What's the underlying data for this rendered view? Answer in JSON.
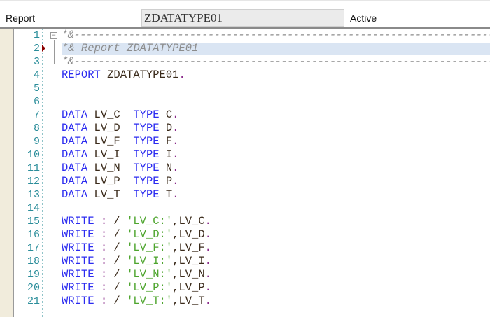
{
  "header": {
    "type_label": "Report",
    "program_name": "ZDATATYPE01",
    "status": "Active"
  },
  "editor": {
    "highlighted_line": 2,
    "lines": [
      {
        "n": "1",
        "tokens": [
          [
            "cm",
            "*&---------------------------------------------------------------------"
          ]
        ]
      },
      {
        "n": "2",
        "tokens": [
          [
            "cm",
            "*& Report ZDATATYPE01"
          ]
        ]
      },
      {
        "n": "3",
        "tokens": [
          [
            "cm",
            "*&---------------------------------------------------------------------"
          ]
        ]
      },
      {
        "n": "4",
        "tokens": [
          [
            "kw",
            "REPORT"
          ],
          [
            "tx",
            " ZDATATYPE01"
          ],
          [
            "pu",
            "."
          ]
        ]
      },
      {
        "n": "5",
        "tokens": []
      },
      {
        "n": "6",
        "tokens": []
      },
      {
        "n": "7",
        "tokens": [
          [
            "kw",
            "DATA"
          ],
          [
            "tx",
            " LV_C  "
          ],
          [
            "kw",
            "TYPE"
          ],
          [
            "tx",
            " C"
          ],
          [
            "pu",
            "."
          ]
        ]
      },
      {
        "n": "8",
        "tokens": [
          [
            "kw",
            "DATA"
          ],
          [
            "tx",
            " LV_D  "
          ],
          [
            "kw",
            "TYPE"
          ],
          [
            "tx",
            " D"
          ],
          [
            "pu",
            "."
          ]
        ]
      },
      {
        "n": "9",
        "tokens": [
          [
            "kw",
            "DATA"
          ],
          [
            "tx",
            " LV_F  "
          ],
          [
            "kw",
            "TYPE"
          ],
          [
            "tx",
            " F"
          ],
          [
            "pu",
            "."
          ]
        ]
      },
      {
        "n": "10",
        "tokens": [
          [
            "kw",
            "DATA"
          ],
          [
            "tx",
            " LV_I  "
          ],
          [
            "kw",
            "TYPE"
          ],
          [
            "tx",
            " I"
          ],
          [
            "pu",
            "."
          ]
        ]
      },
      {
        "n": "11",
        "tokens": [
          [
            "kw",
            "DATA"
          ],
          [
            "tx",
            " LV_N  "
          ],
          [
            "kw",
            "TYPE"
          ],
          [
            "tx",
            " N"
          ],
          [
            "pu",
            "."
          ]
        ]
      },
      {
        "n": "12",
        "tokens": [
          [
            "kw",
            "DATA"
          ],
          [
            "tx",
            " LV_P  "
          ],
          [
            "kw",
            "TYPE"
          ],
          [
            "tx",
            " P"
          ],
          [
            "pu",
            "."
          ]
        ]
      },
      {
        "n": "13",
        "tokens": [
          [
            "kw",
            "DATA"
          ],
          [
            "tx",
            " LV_T  "
          ],
          [
            "kw",
            "TYPE"
          ],
          [
            "tx",
            " T"
          ],
          [
            "pu",
            "."
          ]
        ]
      },
      {
        "n": "14",
        "tokens": []
      },
      {
        "n": "15",
        "tokens": [
          [
            "kw",
            "WRITE"
          ],
          [
            "pu",
            " :"
          ],
          [
            "tx",
            " / "
          ],
          [
            "str",
            "'LV_C:'"
          ],
          [
            "tx",
            ",LV_C"
          ],
          [
            "pu",
            "."
          ]
        ]
      },
      {
        "n": "16",
        "tokens": [
          [
            "kw",
            "WRITE"
          ],
          [
            "pu",
            " :"
          ],
          [
            "tx",
            " / "
          ],
          [
            "str",
            "'LV_D:'"
          ],
          [
            "tx",
            ",LV_D"
          ],
          [
            "pu",
            "."
          ]
        ]
      },
      {
        "n": "17",
        "tokens": [
          [
            "kw",
            "WRITE"
          ],
          [
            "pu",
            " :"
          ],
          [
            "tx",
            " / "
          ],
          [
            "str",
            "'LV_F:'"
          ],
          [
            "tx",
            ",LV_F"
          ],
          [
            "pu",
            "."
          ]
        ]
      },
      {
        "n": "18",
        "tokens": [
          [
            "kw",
            "WRITE"
          ],
          [
            "pu",
            " :"
          ],
          [
            "tx",
            " / "
          ],
          [
            "str",
            "'LV_I:'"
          ],
          [
            "tx",
            ",LV_I"
          ],
          [
            "pu",
            "."
          ]
        ]
      },
      {
        "n": "19",
        "tokens": [
          [
            "kw",
            "WRITE"
          ],
          [
            "pu",
            " :"
          ],
          [
            "tx",
            " / "
          ],
          [
            "str",
            "'LV_N:'"
          ],
          [
            "tx",
            ",LV_N"
          ],
          [
            "pu",
            "."
          ]
        ]
      },
      {
        "n": "20",
        "tokens": [
          [
            "kw",
            "WRITE"
          ],
          [
            "pu",
            " :"
          ],
          [
            "tx",
            " / "
          ],
          [
            "str",
            "'LV_P:'"
          ],
          [
            "tx",
            ",LV_P"
          ],
          [
            "pu",
            "."
          ]
        ]
      },
      {
        "n": "21",
        "tokens": [
          [
            "kw",
            "WRITE"
          ],
          [
            "pu",
            " :"
          ],
          [
            "tx",
            " / "
          ],
          [
            "str",
            "'LV_T:'"
          ],
          [
            "tx",
            ",LV_T"
          ],
          [
            "pu",
            "."
          ]
        ]
      }
    ]
  }
}
